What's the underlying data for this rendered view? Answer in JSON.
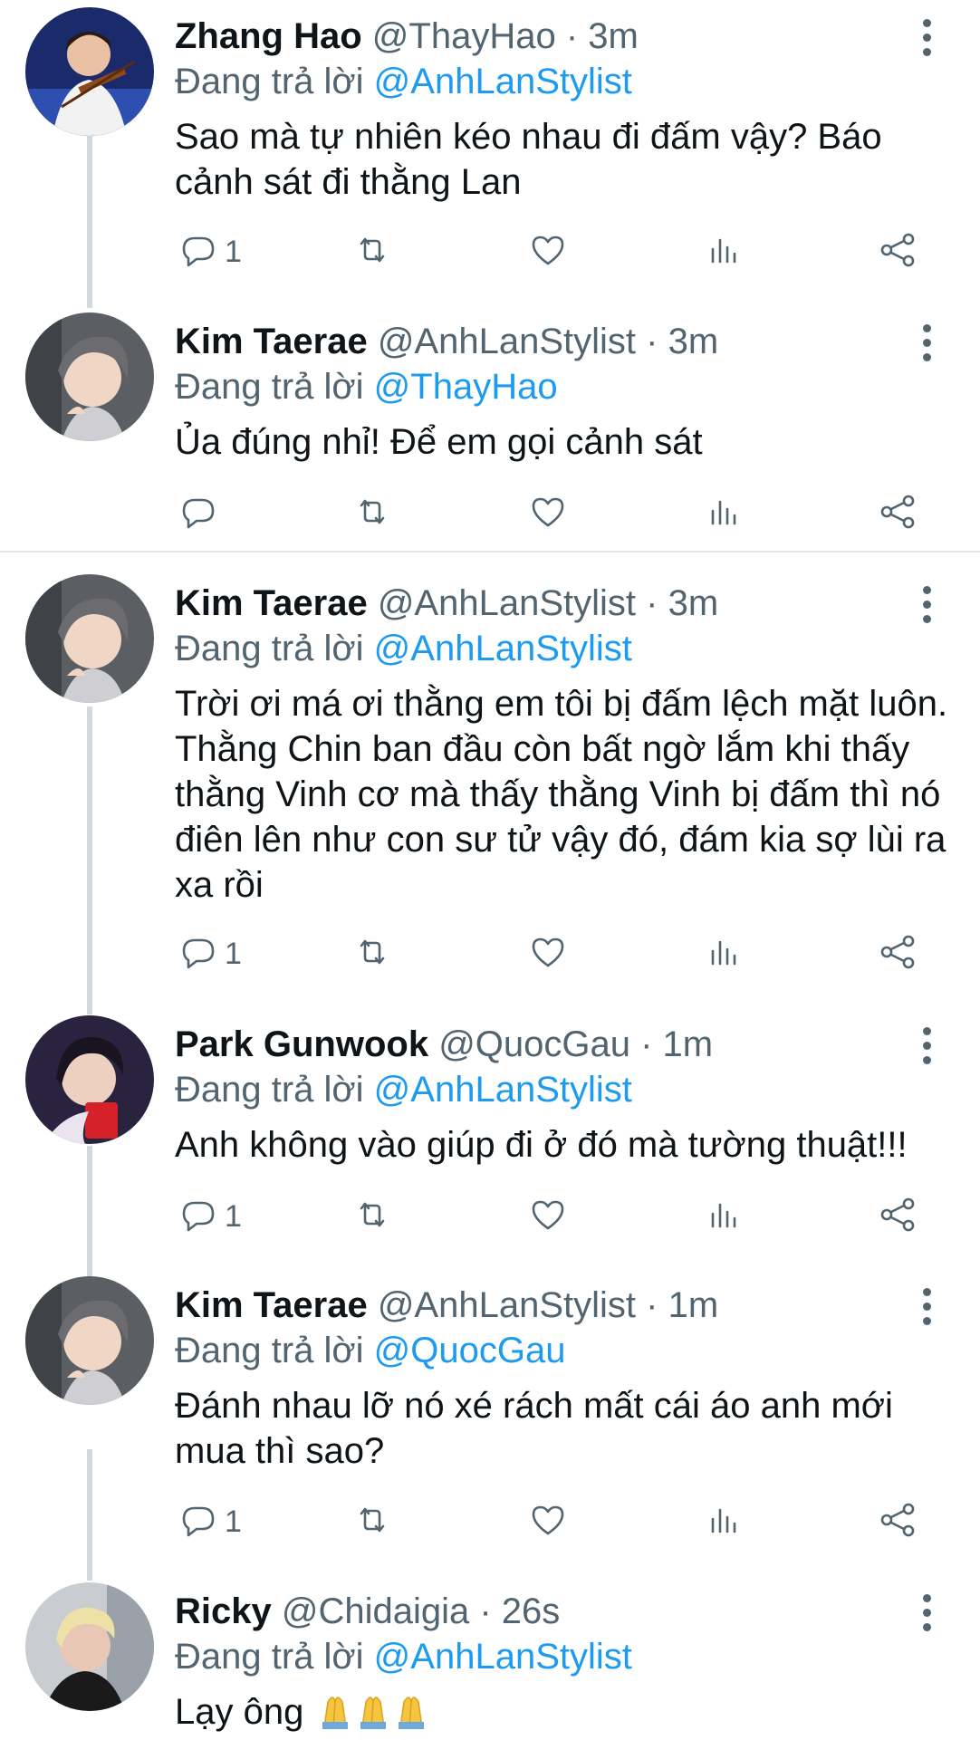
{
  "tweets": [
    {
      "name": "Zhang Hao",
      "meta": "@ThayHao · 3m",
      "reply_prefix": "Đang trả lời",
      "reply_to": "@AnhLanStylist",
      "text": "Sao mà tự nhiên kéo nhau đi đấm vậy? Báo cảnh sát đi thằng Lan",
      "reply_count": "1"
    },
    {
      "name": "Kim Taerae",
      "meta": "@AnhLanStylist · 3m",
      "reply_prefix": "Đang trả lời",
      "reply_to": "@ThayHao",
      "text": "Ủa đúng nhỉ! Để em gọi cảnh sát",
      "reply_count": ""
    },
    {
      "name": "Kim Taerae",
      "meta": "@AnhLanStylist · 3m",
      "reply_prefix": "Đang trả lời",
      "reply_to": "@AnhLanStylist",
      "text": "Trời ơi má ơi thằng em tôi bị đấm lệch mặt luôn. Thằng Chin ban đầu còn bất ngờ lắm khi thấy thằng Vinh cơ mà thấy thằng Vinh bị đấm thì nó điên lên như con sư tử vậy đó, đám kia sợ lùi ra xa rồi",
      "reply_count": "1"
    },
    {
      "name": "Park Gunwook",
      "meta": "@QuocGau · 1m",
      "reply_prefix": "Đang trả lời",
      "reply_to": "@AnhLanStylist",
      "text": "Anh không vào giúp đi ở đó mà tường thuật!!!",
      "reply_count": "1"
    },
    {
      "name": "Kim Taerae",
      "meta": "@AnhLanStylist · 1m",
      "reply_prefix": "Đang trả lời",
      "reply_to": "@QuocGau",
      "text": "Đánh nhau lỡ nó xé rách mất cái áo anh mới mua thì sao?",
      "reply_count": "1"
    },
    {
      "name": "Ricky",
      "meta": "@Chidaigia · 26s",
      "reply_prefix": "Đang trả lời",
      "reply_to": "@AnhLanStylist",
      "text": "Lạy ông",
      "text_emoji": "🙏🙏🙏",
      "reply_count": ""
    }
  ],
  "icons": {
    "reply": "reply-icon",
    "retweet": "retweet-icon",
    "like": "like-icon",
    "views": "views-icon",
    "share": "share-icon",
    "more": "more-icon"
  },
  "colors": {
    "link": "#1d9bf0",
    "secondary_text": "#536471",
    "thread_line": "#cfd9de"
  }
}
